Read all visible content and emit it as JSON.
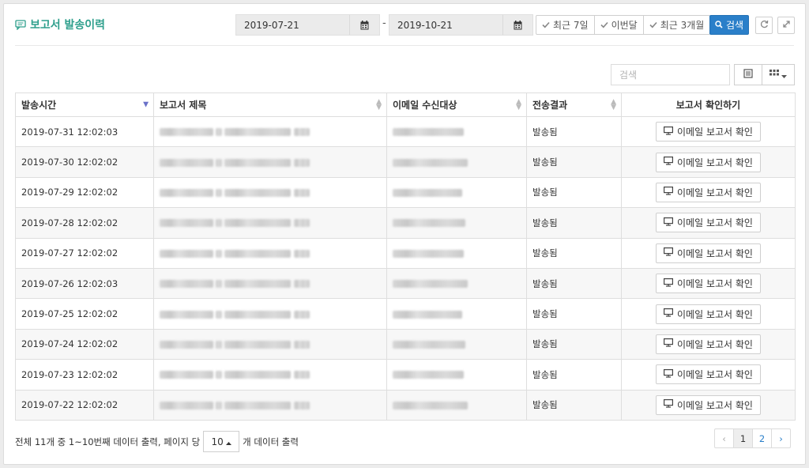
{
  "header": {
    "title": "보고서 발송이력",
    "date_from": "2019-07-21",
    "date_to": "2019-10-21",
    "date_separator": "-",
    "quick_ranges": [
      "최근 7일",
      "이번달",
      "최근 3개월"
    ],
    "search_label": "검색"
  },
  "toolbar": {
    "search_placeholder": "검색"
  },
  "table": {
    "columns": [
      "발송시간",
      "보고서 제목",
      "이메일 수신대상",
      "전송결과",
      "보고서 확인하기"
    ],
    "rows": [
      {
        "time": "2019-07-31 12:02:03",
        "result": "발송됨",
        "action": "이메일 보고서 확인"
      },
      {
        "time": "2019-07-30 12:02:02",
        "result": "발송됨",
        "action": "이메일 보고서 확인"
      },
      {
        "time": "2019-07-29 12:02:02",
        "result": "발송됨",
        "action": "이메일 보고서 확인"
      },
      {
        "time": "2019-07-28 12:02:02",
        "result": "발송됨",
        "action": "이메일 보고서 확인"
      },
      {
        "time": "2019-07-27 12:02:02",
        "result": "발송됨",
        "action": "이메일 보고서 확인"
      },
      {
        "time": "2019-07-26 12:02:03",
        "result": "발송됨",
        "action": "이메일 보고서 확인"
      },
      {
        "time": "2019-07-25 12:02:02",
        "result": "발송됨",
        "action": "이메일 보고서 확인"
      },
      {
        "time": "2019-07-24 12:02:02",
        "result": "발송됨",
        "action": "이메일 보고서 확인"
      },
      {
        "time": "2019-07-23 12:02:02",
        "result": "발송됨",
        "action": "이메일 보고서 확인"
      },
      {
        "time": "2019-07-22 12:02:02",
        "result": "발송됨",
        "action": "이메일 보고서 확인"
      }
    ]
  },
  "footer": {
    "info_prefix": "전체 11개 중 1~10번째 데이터 출력, 페이지 당",
    "page_size": "10",
    "info_suffix": "개 데이터 출력",
    "pages": [
      "‹",
      "1",
      "2",
      "›"
    ],
    "current_page": "1"
  },
  "colors": {
    "title": "#2e9f8c",
    "primary_button": "#2a7fc9",
    "sort_active": "#6b72c9"
  },
  "icons": [
    "comment-icon",
    "calendar-icon",
    "check-icon",
    "search-icon",
    "refresh-icon",
    "expand-icon",
    "list-view-icon",
    "grid-view-icon",
    "caret-down-icon",
    "caret-up-icon",
    "monitor-icon",
    "sort-icon"
  ]
}
